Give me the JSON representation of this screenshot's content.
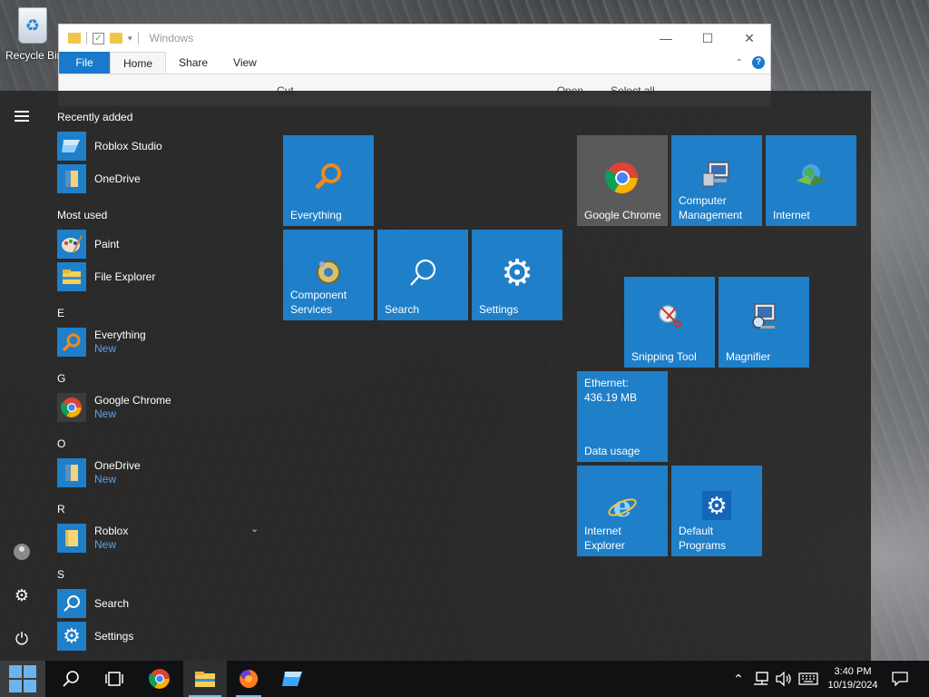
{
  "desktop": {
    "recycle_bin_label": "Recycle Bin"
  },
  "explorer": {
    "title": "Windows",
    "tabs": [
      "File",
      "Home",
      "Share",
      "View"
    ],
    "ribbon": {
      "cut": "Cut",
      "open": "Open",
      "select_all": "Select all"
    }
  },
  "start": {
    "groups": {
      "recently_added": "Recently added",
      "most_used": "Most used",
      "e": "E",
      "g": "G",
      "o": "O",
      "r": "R",
      "s": "S"
    },
    "apps": {
      "roblox_studio": "Roblox Studio",
      "onedrive_recent": "OneDrive",
      "paint": "Paint",
      "file_explorer": "File Explorer",
      "everything": "Everything",
      "google_chrome": "Google Chrome",
      "onedrive": "OneDrive",
      "roblox": "Roblox",
      "search": "Search",
      "settings": "Settings",
      "new_badge": "New"
    },
    "tiles": {
      "everything": "Everything",
      "component_services_1": "Component",
      "component_services_2": "Services",
      "search": "Search",
      "settings": "Settings",
      "google_chrome": "Google Chrome",
      "computer_management_1": "Computer",
      "computer_management_2": "Management",
      "internet": "Internet",
      "snipping_tool": "Snipping Tool",
      "magnifier": "Magnifier",
      "ethernet_label": "Ethernet:",
      "ethernet_value": "436.19 MB",
      "data_usage": "Data usage",
      "internet_explorer_1": "Internet",
      "internet_explorer_2": "Explorer",
      "default_programs_1": "Default",
      "default_programs_2": "Programs"
    }
  },
  "taskbar": {
    "time": "3:40 PM",
    "date": "10/19/2024"
  },
  "colors": {
    "tile_blue": "#1f7fc9",
    "start_bg": "#282828",
    "taskbar_bg": "#101113",
    "new_badge": "#5ba3e6"
  },
  "icons": {
    "rail": [
      "hamburger-icon",
      "user-icon",
      "gear-icon",
      "power-icon"
    ],
    "taskbar": [
      "windows-logo-icon",
      "search-icon",
      "task-view-icon",
      "chrome-icon",
      "file-explorer-icon",
      "firefox-icon",
      "roblox-studio-icon",
      "chevron-up-icon",
      "network-icon",
      "volume-icon",
      "keyboard-icon",
      "notification-icon"
    ]
  }
}
